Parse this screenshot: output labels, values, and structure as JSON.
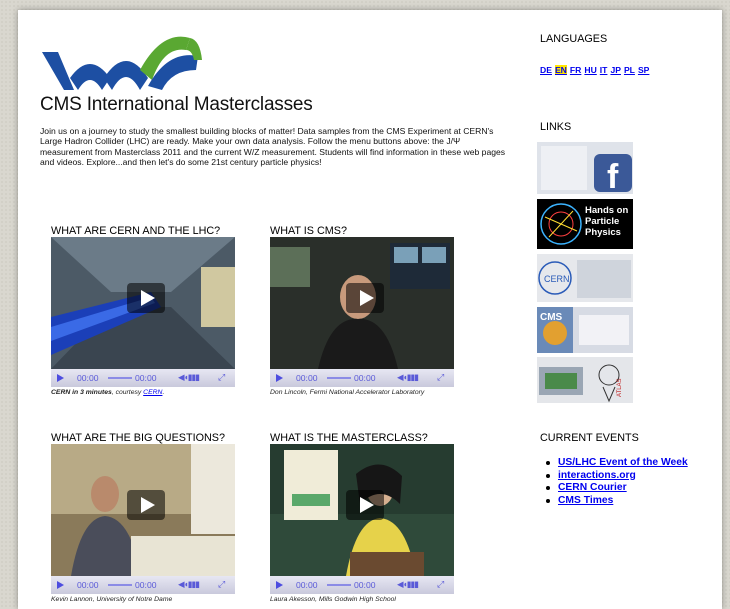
{
  "site": {
    "title": "CMS International Masterclasses",
    "intro": "Join us on a journey to study the smallest building blocks of matter! Data samples from the CMS Experiment at CERN's Large Hadron Collider (LHC) are ready. Make your own data analysis. Follow the menu buttons above: the J/Ψ measurement from Masterclass 2011 and the current W/Z measurement. Students will find information in these web pages and videos. Explore...and then let's do some 21st century particle physics!",
    "logo_colors": {
      "blue": "#1d4fa3",
      "green": "#5aa832"
    }
  },
  "videos": [
    {
      "title": "WHAT ARE CERN AND THE LHC?",
      "caption_bold": "CERN in 3 minutes",
      "caption_mid": ", courtesy ",
      "caption_link": "CERN",
      "caption_end": ".",
      "time_current": "00:00",
      "time_total": "00:00"
    },
    {
      "title": "WHAT IS CMS?",
      "caption": "Don Lincoln, Fermi National Accelerator Laboratory",
      "time_current": "00:00",
      "time_total": "00:00"
    },
    {
      "title": "WHAT ARE THE BIG QUESTIONS?",
      "caption": "Kevin Lannon, University of Notre Dame",
      "time_current": "00:00",
      "time_total": "00:00"
    },
    {
      "title": "WHAT IS THE MASTERCLASS?",
      "caption": "Laura Akesson, Mills Godwin High School",
      "time_current": "00:00",
      "time_total": "00:00"
    }
  ],
  "sidebar": {
    "languages_heading": "LANGUAGES",
    "languages": [
      "DE",
      "EN",
      "FR",
      "HU",
      "IT",
      "JP",
      "PL",
      "SP"
    ],
    "active_language": "EN",
    "links_heading": "LINKS",
    "links": [
      {
        "icon": "facebook-icon",
        "text": "f"
      },
      {
        "icon": "hands-on-particle-physics-logo",
        "text": "Hands on Particle Physics"
      },
      {
        "icon": "cern-logo",
        "text": "CERN"
      },
      {
        "icon": "cms-logo",
        "text": "CMS"
      },
      {
        "icon": "atlas-logo",
        "text": "ATLAS"
      }
    ],
    "events_heading": "CURRENT EVENTS",
    "events": [
      "US/LHC Event of the Week",
      "interactions.org",
      "CERN Courier",
      "CMS Times"
    ]
  }
}
